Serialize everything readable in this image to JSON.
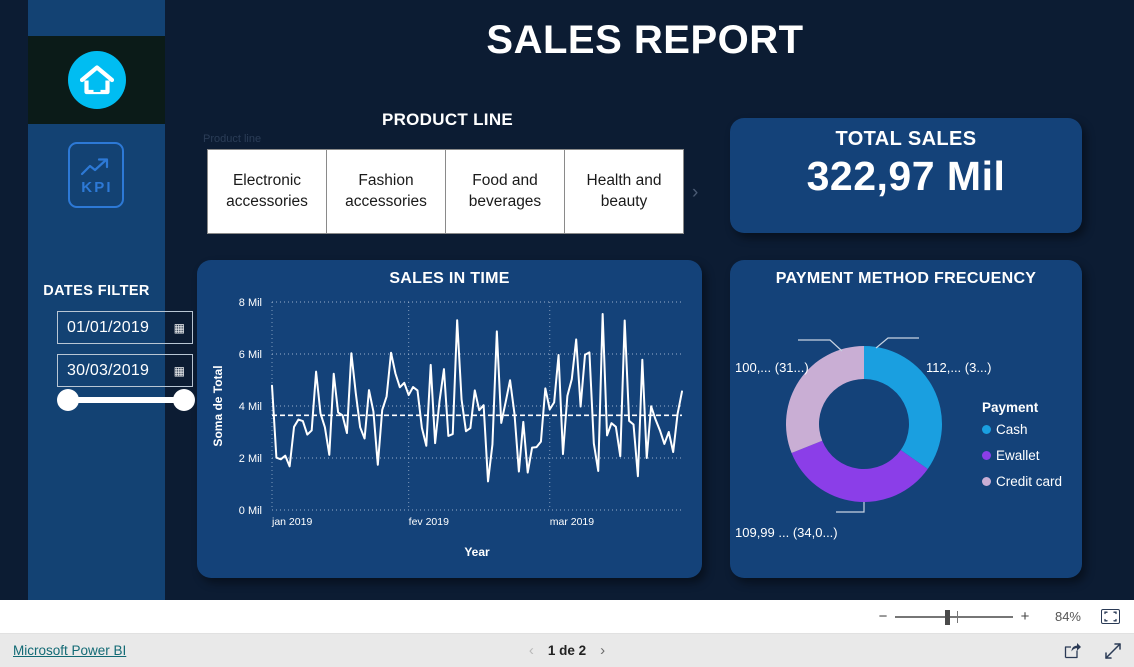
{
  "report": {
    "title": "SALES REPORT"
  },
  "sidebar": {
    "home_icon": "home-icon",
    "kpi_icon": "trending-up-icon",
    "kpi_label": "KPI",
    "dates_filter": {
      "title": "DATES FILTER",
      "from_value": "01/01/2019",
      "to_value": "30/03/2019",
      "calendar_icon": "calendar-icon"
    }
  },
  "product_line": {
    "title": "PRODUCT LINE",
    "sublabel": "Product line",
    "next_chevron": "›",
    "tiles": [
      {
        "label": "Electronic accessories"
      },
      {
        "label": "Fashion accessories"
      },
      {
        "label": "Food and beverages"
      },
      {
        "label": "Health and beauty"
      }
    ]
  },
  "total_sales": {
    "title": "TOTAL SALES",
    "value": "322,97 Mil"
  },
  "zoom_bar": {
    "minus": "−",
    "plus": "+",
    "percent": "84%",
    "fit_icon": "fit-to-screen-icon"
  },
  "footer": {
    "brand_link": "Microsoft Power BI",
    "page_prev": "‹",
    "page_indicator": "1 de 2",
    "page_next": "›",
    "share_icon": "share-icon",
    "fullscreen_icon": "fullscreen-icon"
  },
  "colors": {
    "canvas_bg": "#0c1c33",
    "sidebar_bg": "#134273",
    "card_bg": "#144279",
    "accent_cyan": "#00bdf2",
    "kpi_blue": "#2d79d6",
    "series_line": "#ffffff",
    "cash": "#1a9fe0",
    "ewallet": "#8b3ee8",
    "credit_card": "#c9aed4"
  },
  "chart_data": [
    {
      "type": "line",
      "title": "SALES IN TIME",
      "xlabel": "Year",
      "ylabel": "Soma de Total",
      "ylim": [
        0,
        8000
      ],
      "ytick_labels": [
        "0 Mil",
        "2 Mil",
        "4 Mil",
        "6 Mil",
        "8 Mil"
      ],
      "ytick_values": [
        0,
        2000,
        4000,
        6000,
        8000
      ],
      "xtick_labels": [
        "jan 2019",
        "fev 2019",
        "mar 2019"
      ],
      "grid": true,
      "average_line": 3640,
      "series": [
        {
          "name": "Soma de Total",
          "color": "#ffffff",
          "values": [
            4780,
            2010,
            1950,
            2090,
            1680,
            3200,
            3480,
            3420,
            2900,
            3060,
            5320,
            3720,
            3180,
            2120,
            5240,
            3750,
            3640,
            2960,
            6030,
            4500,
            3180,
            2750,
            4610,
            3790,
            1740,
            3850,
            4370,
            6050,
            5250,
            4720,
            4890,
            4420,
            4730,
            4600,
            3160,
            2470,
            5580,
            2570,
            4190,
            5420,
            2850,
            2920,
            7300,
            4250,
            3030,
            3150,
            4600,
            3840,
            4030,
            1100,
            2520,
            6870,
            3350,
            4150,
            4990,
            3700,
            1480,
            3390,
            1440,
            2400,
            2420,
            2630,
            4680,
            3870,
            4140,
            5960,
            2150,
            4390,
            5030,
            6560,
            3980,
            5970,
            6060,
            2560,
            1500,
            7540,
            2870,
            3340,
            3200,
            2070,
            7290,
            3430,
            3290,
            1300,
            5780,
            2000,
            3990,
            3480,
            3060,
            2540,
            3000,
            2230,
            3700,
            4560
          ]
        }
      ]
    },
    {
      "type": "pie",
      "title": "PAYMENT METHOD FRECUENCY",
      "legend_title": "Payment",
      "legend_position": "right",
      "donut": true,
      "categories": [
        "Cash",
        "Ewallet",
        "Credit card"
      ],
      "values": [
        112,
        109.99,
        100
      ],
      "colors": [
        "#1a9fe0",
        "#8b3ee8",
        "#c9aed4"
      ],
      "annotations": [
        {
          "for": "Cash",
          "label": "112,... (3...)"
        },
        {
          "for": "Ewallet",
          "label": "109,99 ... (34,0...)"
        },
        {
          "for": "Credit card",
          "label": "100,... (31...)"
        }
      ]
    }
  ]
}
